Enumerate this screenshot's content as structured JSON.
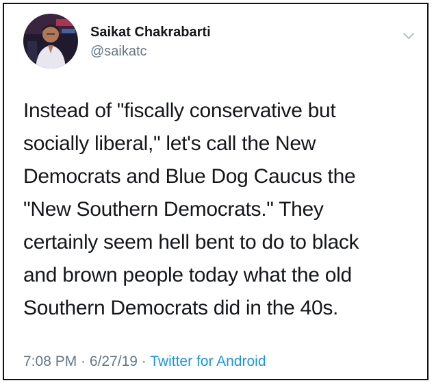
{
  "user": {
    "display_name": "Saikat Chakrabarti",
    "handle": "@saikatc"
  },
  "tweet": {
    "lines": [
      "Instead of \"fiscally conservative but",
      "socially liberal,\" let's call the New",
      "Democrats and Blue Dog Caucus the",
      "\"New Southern Democrats.\" They",
      "certainly seem hell bent to do to black",
      "and brown people today what the old",
      "Southern Democrats did in the 40s."
    ]
  },
  "meta": {
    "time": "7:08 PM",
    "separator_1": " · ",
    "date": "6/27/19",
    "separator_2": " · ",
    "source": "Twitter for Android"
  },
  "icons": {
    "menu": "chevron-down-icon",
    "avatar": "avatar"
  },
  "colors": {
    "text_primary": "#14171a",
    "text_secondary": "#657786",
    "link": "#1b95e0"
  }
}
